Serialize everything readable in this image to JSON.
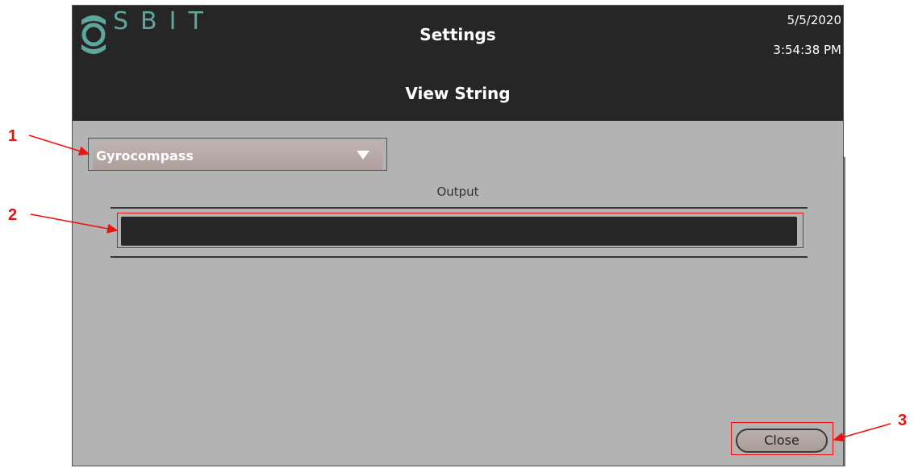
{
  "header": {
    "brand": "SBIT",
    "title": "Settings",
    "subtitle": "View String",
    "date": "5/5/2020",
    "time": "3:54:38 PM"
  },
  "form": {
    "dropdown_value": "Gyrocompass",
    "output_label": "Output",
    "output_value": ""
  },
  "footer": {
    "close_label": "Close"
  },
  "annotations": {
    "callouts": [
      "1",
      "2",
      "3"
    ],
    "color": "#e11111"
  },
  "colors": {
    "header_bg": "#262626",
    "body_bg": "#b3b3b3",
    "brand": "#5fa79c"
  }
}
